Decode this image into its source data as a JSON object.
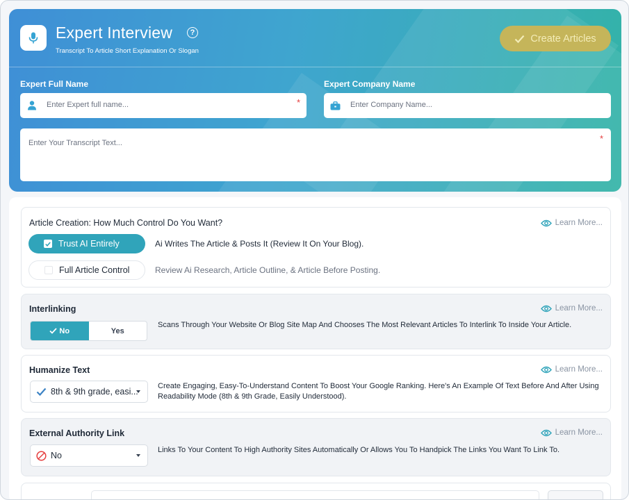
{
  "header": {
    "title": "Expert Interview",
    "subtitle": "Transcript To Article Short Explanation Or Slogan",
    "create_button": "Create Articles"
  },
  "form": {
    "expert_name_label": "Expert Full Name",
    "expert_name_placeholder": "Enter Expert full name...",
    "company_label": "Expert Company Name",
    "company_placeholder": "Enter Company Name...",
    "transcript_placeholder": "Enter Your Transcript Text...",
    "required_mark": "*"
  },
  "control": {
    "title": "Article Creation: How Much Control Do You Want?",
    "learn_more": "Learn More...",
    "options": [
      {
        "label": "Trust AI Entirely",
        "desc": "Ai Writes The Article & Posts It (Review It On Your Blog).",
        "selected": true
      },
      {
        "label": "Full Article Control",
        "desc": "Review Ai Research, Article Outline, & Article Before Posting.",
        "selected": false
      }
    ]
  },
  "interlinking": {
    "title": "Interlinking",
    "learn_more": "Learn More...",
    "no_label": "No",
    "yes_label": "Yes",
    "selected": "No",
    "desc": "Scans Through Your Website Or Blog Site Map And Chooses The Most Relevant Articles To Interlink To Inside Your Article."
  },
  "humanize": {
    "title": "Humanize Text",
    "learn_more": "Learn More...",
    "selected": "8th & 9th grade, easi...",
    "desc": "Create Engaging, Easy-To-Understand Content To Boost Your Google Ranking. Here's An Example Of Text Before And After Using Readability Mode (8th & 9th Grade, Easily Understood)."
  },
  "external": {
    "title": "External Authority Link",
    "learn_more": "Learn More...",
    "selected": "No",
    "desc": "Links To Your Content To High Authority Sites Automatically Or Allows You To Handpick The Links You Want To Link To."
  },
  "colors": {
    "accent": "#30a4ba",
    "create_button": "#c5b55a",
    "required": "#e53e3e"
  }
}
